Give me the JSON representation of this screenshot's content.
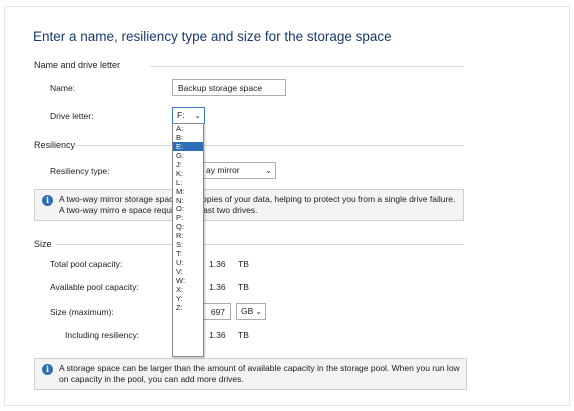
{
  "heading": "Enter a name, resiliency type and size for the storage space",
  "name_section": {
    "title": "Name and drive letter",
    "name_label": "Name:",
    "name_value": "Backup storage space",
    "drive_label": "Drive letter:",
    "drive_value": "F:"
  },
  "resiliency": {
    "title": "Resiliency",
    "type_label": "Resiliency type:",
    "type_value": "ay mirror",
    "info": "A two-way mirror storage spac    s two copies of your data, helping to protect you from a single drive failure. A two-way mirro    e space requires at least two drives."
  },
  "size": {
    "title": "Size",
    "total_label": "Total pool capacity:",
    "total_value": "1.36",
    "total_unit": "TB",
    "avail_label": "Available pool capacity:",
    "avail_value": "1.36",
    "avail_unit": "TB",
    "max_label": "Size (maximum):",
    "max_value": "697",
    "max_unit": "GB",
    "incl_label": "Including resiliency:",
    "incl_value": "1.36",
    "incl_unit": "TB"
  },
  "bottom_info": "A storage space can be larger than the amount of available capacity in the storage pool. When you run low on capacity in the pool, you can add more drives.",
  "drive_options": [
    "A:",
    "B:",
    "E:",
    "G:",
    "J:",
    "K:",
    "L:",
    "M:",
    "N:",
    "O:",
    "P:",
    "Q:",
    "R:",
    "S:",
    "T:",
    "U:",
    "V:",
    "W:",
    "X:",
    "Y:",
    "Z:"
  ],
  "selected_option_index": 2,
  "icons": {
    "info": "info-icon",
    "chevron": "chevron-down-icon"
  },
  "colors": {
    "accent": "#2f6db5",
    "heading": "#1a3a6e"
  }
}
